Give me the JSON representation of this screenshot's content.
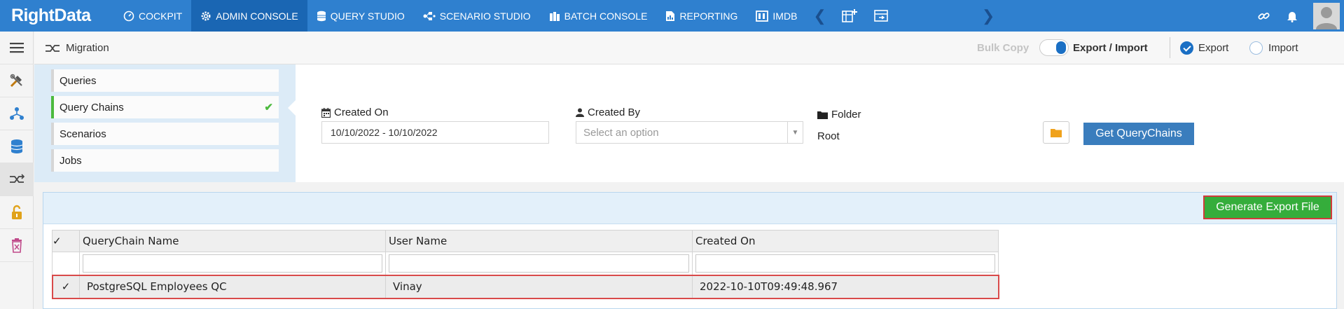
{
  "brand": {
    "name": "RightData"
  },
  "nav": {
    "items": [
      {
        "label": "COCKPIT",
        "icon": "dashboard-icon"
      },
      {
        "label": "ADMIN CONSOLE",
        "icon": "gear-icon",
        "active": true
      },
      {
        "label": "QUERY STUDIO",
        "icon": "database-icon"
      },
      {
        "label": "SCENARIO STUDIO",
        "icon": "flow-icon"
      },
      {
        "label": "BATCH CONSOLE",
        "icon": "batch-icon"
      },
      {
        "label": "REPORTING",
        "icon": "report-icon"
      },
      {
        "label": "IMDB",
        "icon": "imdb-icon"
      }
    ]
  },
  "breadcrumb": {
    "title": "Migration"
  },
  "mode": {
    "bulk_copy": "Bulk Copy",
    "export_import": "Export / Import",
    "export": "Export",
    "import": "Import",
    "selected": "Export"
  },
  "tabs": {
    "items": [
      {
        "label": "Queries"
      },
      {
        "label": "Query Chains",
        "active": true
      },
      {
        "label": "Scenarios"
      },
      {
        "label": "Jobs"
      }
    ]
  },
  "filters": {
    "created_on_label": "Created On",
    "created_on_value": "10/10/2022 - 10/10/2022",
    "created_by_label": "Created By",
    "created_by_placeholder": "Select an option",
    "folder_label": "Folder",
    "folder_value": "Root",
    "get_button": "Get QueryChains"
  },
  "results": {
    "generate_button": "Generate Export File",
    "columns": [
      "QueryChain Name",
      "User Name",
      "Created On"
    ],
    "rows": [
      {
        "checked": true,
        "name": "PostgreSQL Employees QC",
        "user": "Vinay",
        "created_on": "2022-10-10T09:49:48.967"
      }
    ]
  },
  "colors": {
    "topbar": "#2f80cf",
    "active_nav": "#1a66b3",
    "accent": "#1a6fc4",
    "success": "#35ad3b",
    "highlight_border": "#d13b3b"
  }
}
